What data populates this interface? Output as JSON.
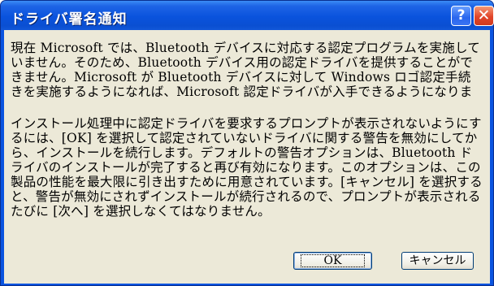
{
  "window": {
    "title": "ドライバ署名通知"
  },
  "titlebar": {
    "help_label": "?",
    "close_label": "✕"
  },
  "message": {
    "paragraph1": "現在 Microsoft では、Bluetooth デバイスに対応する認定プログラムを実施していません。そのため、Bluetooth デバイス用の認定ドライバを提供することができません。Microsoft が Bluetooth デバイスに対して Windows ロゴ認定手続きを実施するようになれば、Microsoft 認定ドライバが入手できるようになります。",
    "paragraph2": "インストール処理中に認定ドライバを要求するプロンプトが表示されないようにするには、[OK] を選択して認定されていないドライバに関する警告を無効にしてから、インストールを続行します。デフォルトの警告オプションは、Bluetooth ドライバのインストールが完了すると再び有効になります。このオプションは、この製品の性能を最大限に引き出すために用意されています。[キャンセル] を選択すると、警告が無効にされずインストールが続行されるので、プロンプトが表示されるたびに [次へ] を選択しなくてはなりません。"
  },
  "buttons": {
    "ok_label": "OK",
    "cancel_label": "キャンセル"
  },
  "colors": {
    "titlebar": "#0a53dd",
    "client": "#ece9d8",
    "close": "#e2452a",
    "help": "#2a66ee"
  }
}
